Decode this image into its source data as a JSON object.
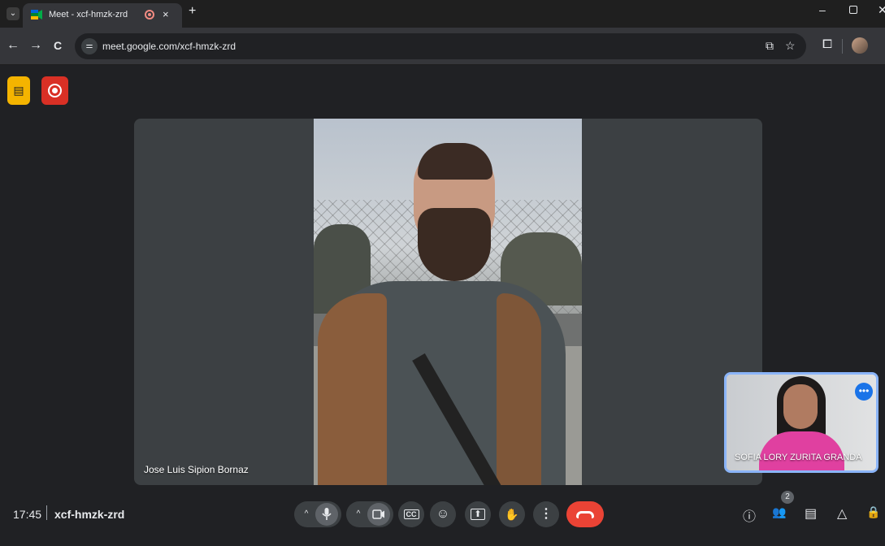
{
  "browser": {
    "tab_title": "Meet - xcf-hmzk-zrd",
    "tab_caret": "⌄",
    "tab_close": "×",
    "new_tab": "+",
    "url": "meet.google.com/xcf-hmzk-zrd",
    "win_min": "–",
    "win_close": "✕"
  },
  "meeting": {
    "main_participant": "Jose Luis Sipion Bornaz",
    "self_participant": "SOFIA LORY ZURITA GRANDA",
    "time": "17:45",
    "code": "xcf-hmzk-zrd",
    "participant_count": "2"
  },
  "icons": {
    "back": "←",
    "forward": "→",
    "reload": "C",
    "site_info": "⚌",
    "cast": "⧉",
    "star": "☆",
    "extensions": "⧠",
    "mic": "🎤",
    "camera": "▭",
    "captions": "CC",
    "emoji": "☺",
    "present": "⬆",
    "hand": "✋",
    "more": "⋮",
    "caret_up": "^",
    "info": "ⓘ",
    "people": "👥",
    "chat": "▤",
    "activities": "△",
    "host": "🔒",
    "self_more": "•••",
    "badge_a": "▤"
  },
  "colors": {
    "end_call": "#ea4335",
    "record_badge": "#d93025",
    "activity_badge": "#f4b400",
    "self_border": "#8ab4f8"
  }
}
